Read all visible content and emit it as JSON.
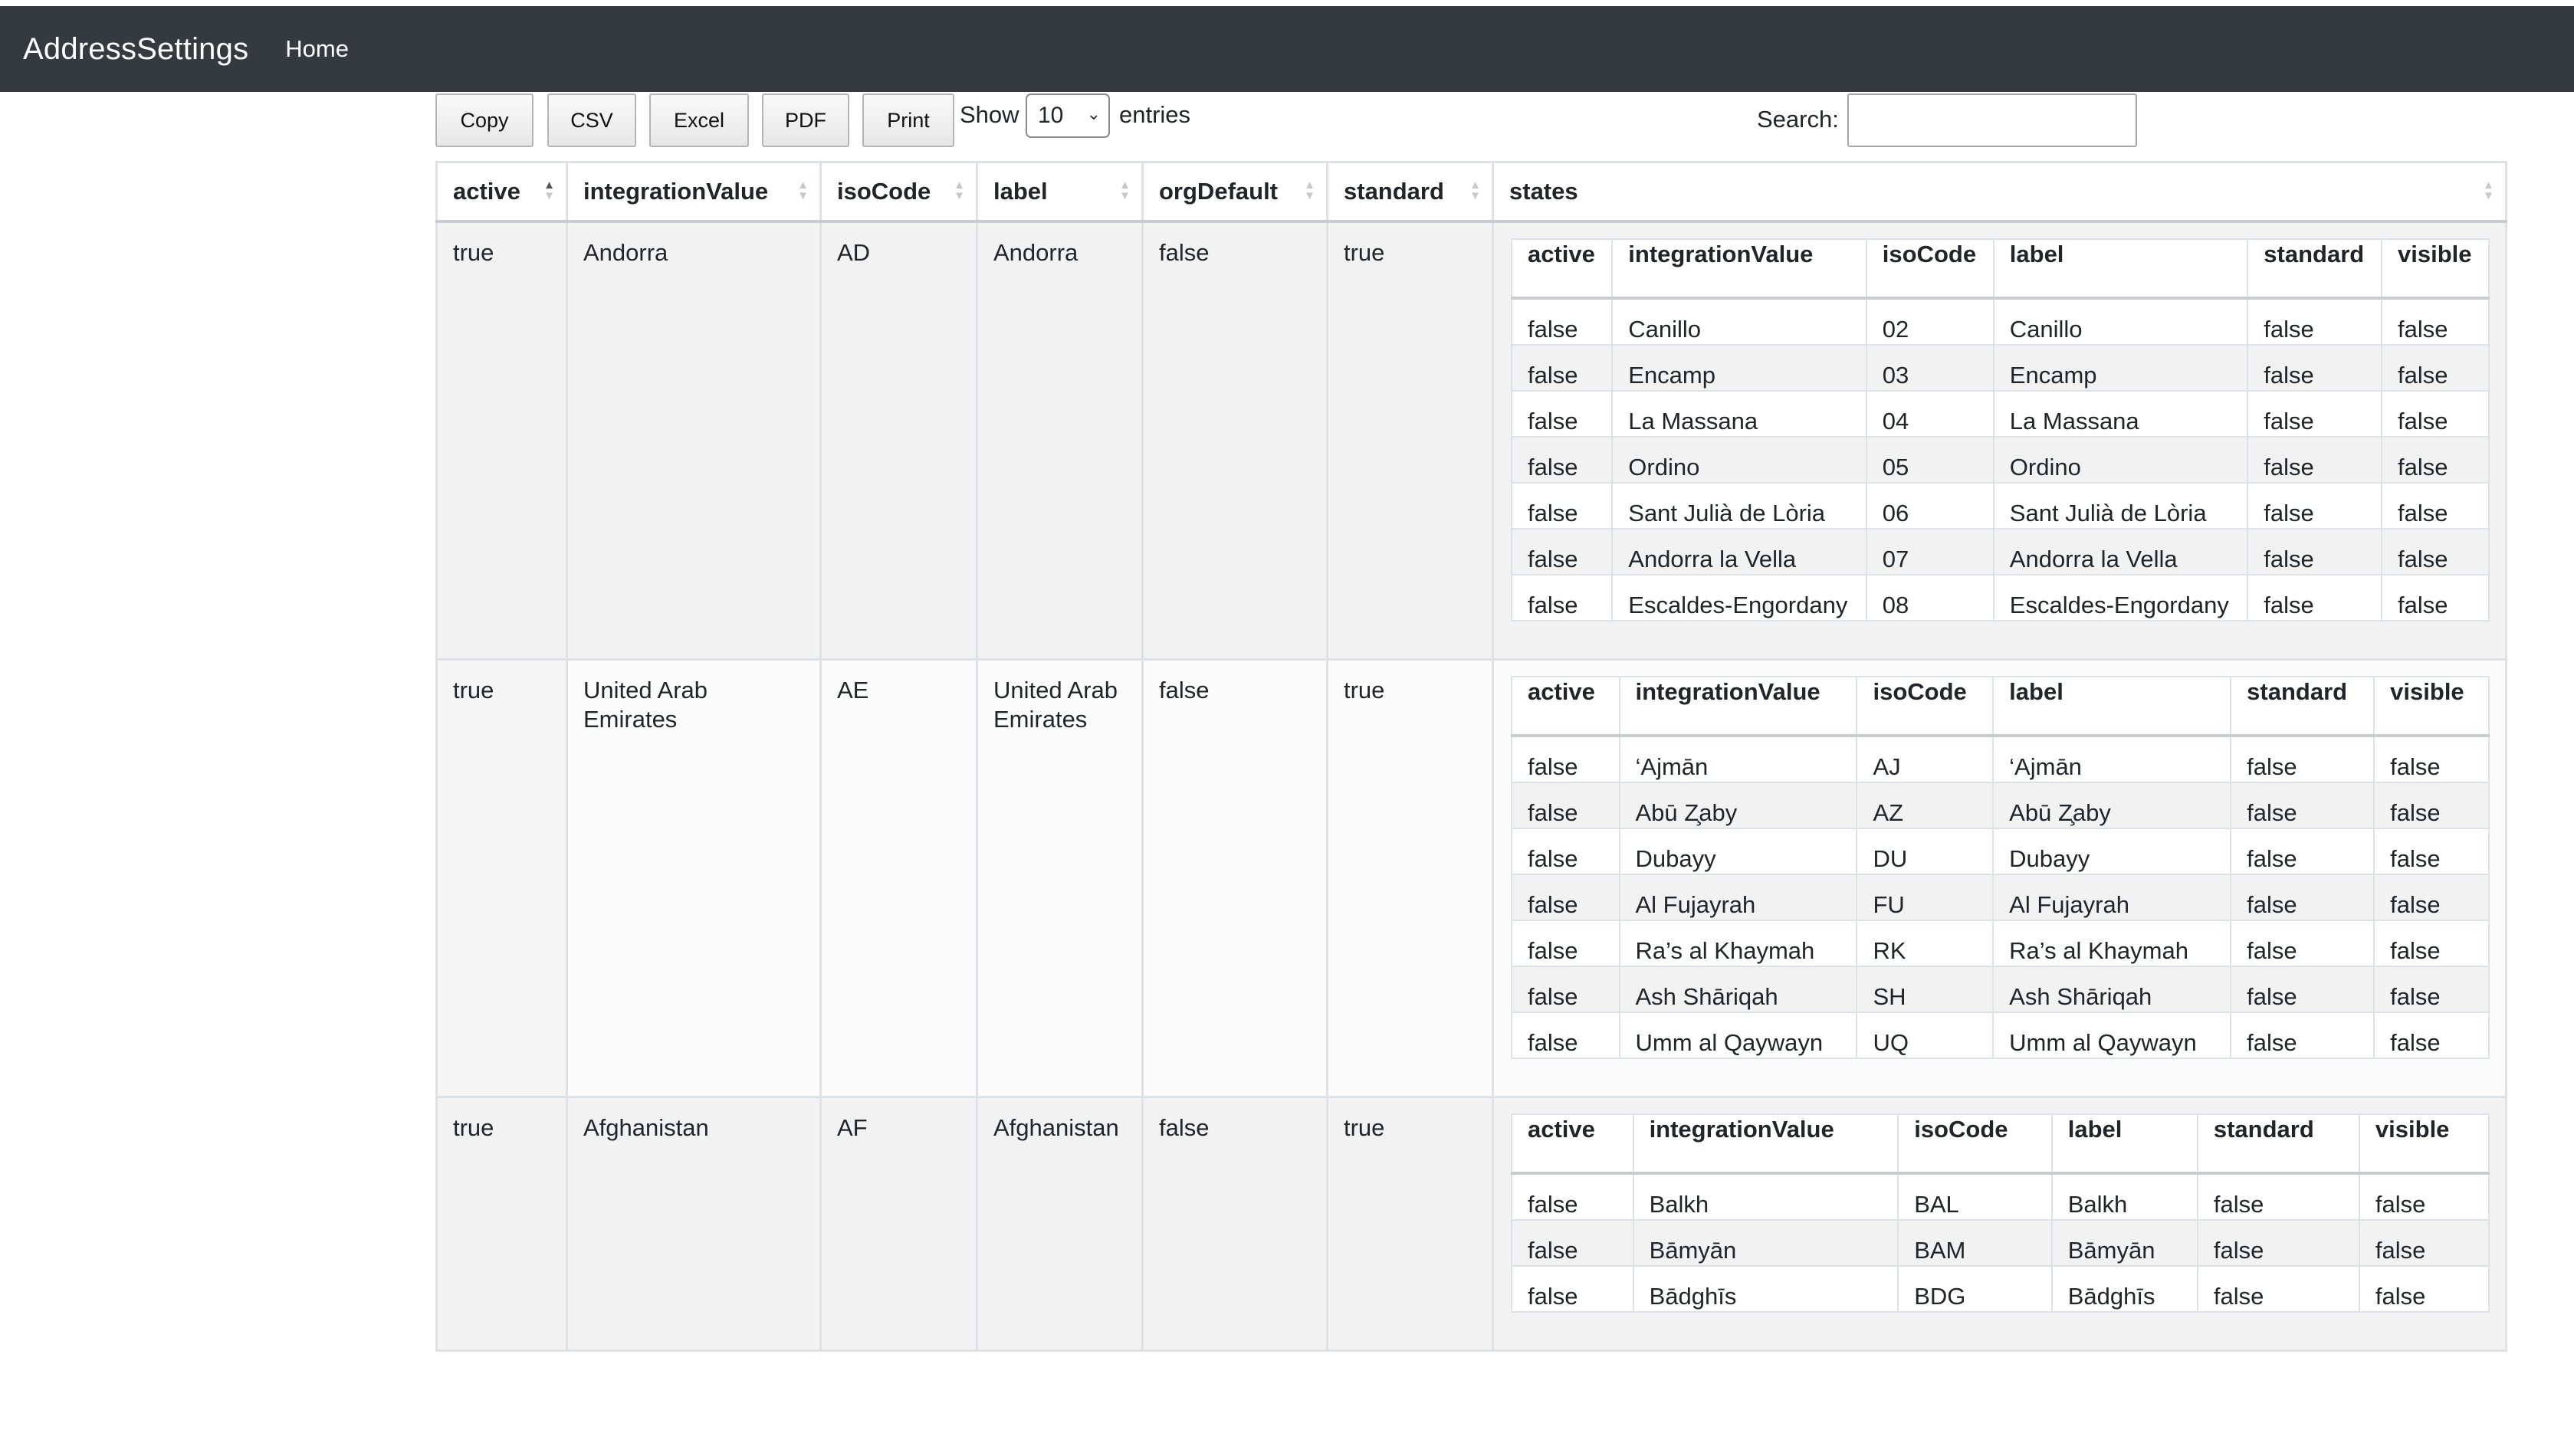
{
  "navbar": {
    "brand": "AddressSettings",
    "home": "Home"
  },
  "toolbar": {
    "buttons": [
      "Copy",
      "CSV",
      "Excel",
      "PDF",
      "Print"
    ],
    "show_label": "Show",
    "length_value": "10",
    "entries_label": "entries",
    "search_label": "Search:",
    "search_value": ""
  },
  "table": {
    "columns": [
      "active",
      "integrationValue",
      "isoCode",
      "label",
      "orgDefault",
      "standard",
      "states"
    ],
    "sorted_column": "active",
    "state_columns": [
      "active",
      "integrationValue",
      "isoCode",
      "label",
      "standard",
      "visible"
    ],
    "rows": [
      {
        "active": "true",
        "integrationValue": "Andorra",
        "isoCode": "AD",
        "label": "Andorra",
        "orgDefault": "false",
        "standard": "true",
        "states": [
          [
            "false",
            "Canillo",
            "02",
            "Canillo",
            "false",
            "false"
          ],
          [
            "false",
            "Encamp",
            "03",
            "Encamp",
            "false",
            "false"
          ],
          [
            "false",
            "La Massana",
            "04",
            "La Massana",
            "false",
            "false"
          ],
          [
            "false",
            "Ordino",
            "05",
            "Ordino",
            "false",
            "false"
          ],
          [
            "false",
            "Sant Julià de Lòria",
            "06",
            "Sant Julià de Lòria",
            "false",
            "false"
          ],
          [
            "false",
            "Andorra la Vella",
            "07",
            "Andorra la Vella",
            "false",
            "false"
          ],
          [
            "false",
            "Escaldes-Engordany",
            "08",
            "Escaldes-Engordany",
            "false",
            "false"
          ]
        ]
      },
      {
        "active": "true",
        "integrationValue": "United Arab Emirates",
        "isoCode": "AE",
        "label": "United Arab Emirates",
        "orgDefault": "false",
        "standard": "true",
        "states": [
          [
            "false",
            "‘Ajmān",
            "AJ",
            "‘Ajmān",
            "false",
            "false"
          ],
          [
            "false",
            "Abū Z̧aby",
            "AZ",
            "Abū Z̧aby",
            "false",
            "false"
          ],
          [
            "false",
            "Dubayy",
            "DU",
            "Dubayy",
            "false",
            "false"
          ],
          [
            "false",
            "Al Fujayrah",
            "FU",
            "Al Fujayrah",
            "false",
            "false"
          ],
          [
            "false",
            "Ra’s al Khaymah",
            "RK",
            "Ra’s al Khaymah",
            "false",
            "false"
          ],
          [
            "false",
            "Ash Shāriqah",
            "SH",
            "Ash Shāriqah",
            "false",
            "false"
          ],
          [
            "false",
            "Umm al Qaywayn",
            "UQ",
            "Umm al Qaywayn",
            "false",
            "false"
          ]
        ]
      },
      {
        "active": "true",
        "integrationValue": "Afghanistan",
        "isoCode": "AF",
        "label": "Afghanistan",
        "orgDefault": "false",
        "standard": "true",
        "states": [
          [
            "false",
            "Balkh",
            "BAL",
            "Balkh",
            "false",
            "false"
          ],
          [
            "false",
            "Bāmyān",
            "BAM",
            "Bāmyān",
            "false",
            "false"
          ],
          [
            "false",
            "Bādghīs",
            "BDG",
            "Bādghīs",
            "false",
            "false"
          ]
        ]
      }
    ]
  }
}
